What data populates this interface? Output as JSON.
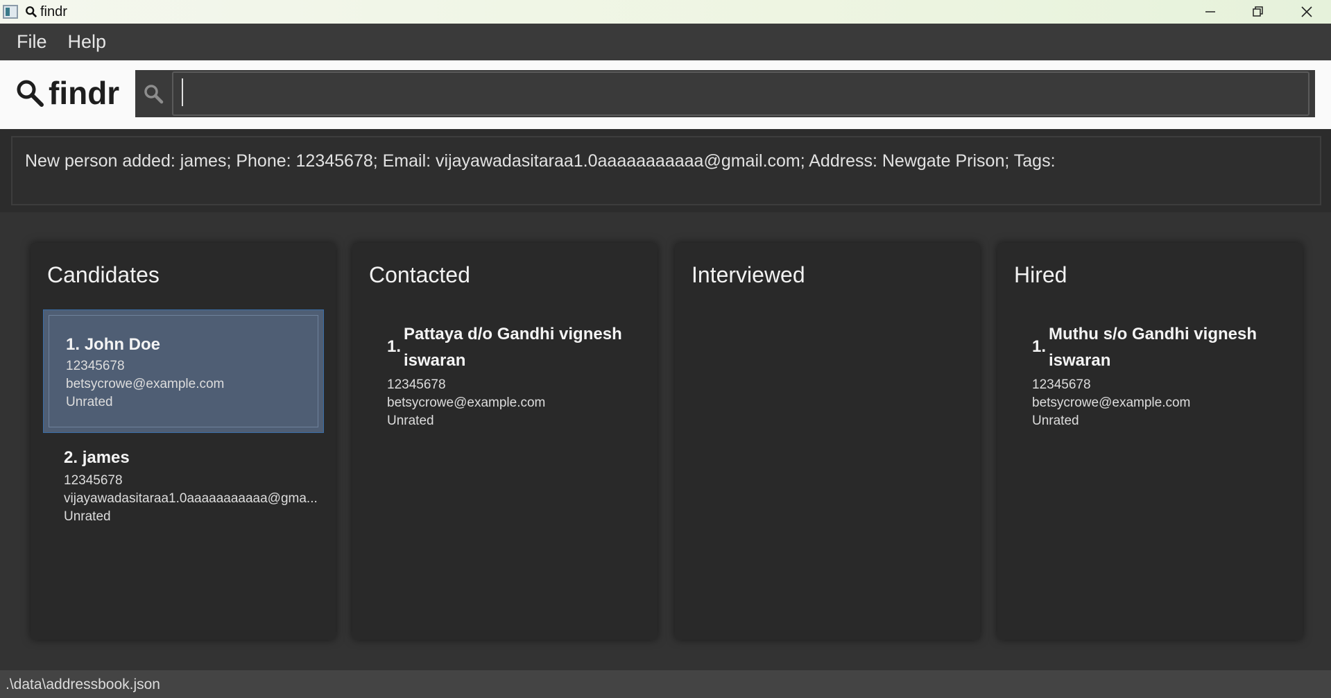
{
  "window": {
    "title": "findr"
  },
  "menu": {
    "items": [
      "File",
      "Help"
    ]
  },
  "header": {
    "logo_text": "findr",
    "search_value": ""
  },
  "result": {
    "message": "New person added: james; Phone: 12345678; Email: vijayawadasitaraa1.0aaaaaaaaaaa@gmail.com; Address: Newgate Prison; Tags:"
  },
  "columns": [
    {
      "title": "Candidates",
      "cards": [
        {
          "index": "1.",
          "name": "John Doe",
          "phone": "12345678",
          "email": "betsycrowe@example.com",
          "rating": "Unrated",
          "selected": true
        },
        {
          "index": "2.",
          "name": "james",
          "phone": "12345678",
          "email": "vijayawadasitaraa1.0aaaaaaaaaaa@gma...",
          "rating": "Unrated",
          "selected": false
        }
      ]
    },
    {
      "title": "Contacted",
      "cards": [
        {
          "index": "1.",
          "name_line1": "Pattaya d/o Gandhi vignesh",
          "name_line2": "iswaran",
          "phone": "12345678",
          "email": "betsycrowe@example.com",
          "rating": "Unrated"
        }
      ]
    },
    {
      "title": "Interviewed",
      "cards": []
    },
    {
      "title": "Hired",
      "cards": [
        {
          "index": "1.",
          "name_line1": "Muthu s/o Gandhi vignesh",
          "name_line2": "iswaran",
          "phone": "12345678",
          "email": "betsycrowe@example.com",
          "rating": "Unrated"
        }
      ]
    }
  ],
  "status": {
    "path": ".\\data\\addressbook.json"
  },
  "colors": {
    "selected_card": "#4f5e74",
    "panel": "#292929",
    "menubar": "#3a3a3a"
  }
}
